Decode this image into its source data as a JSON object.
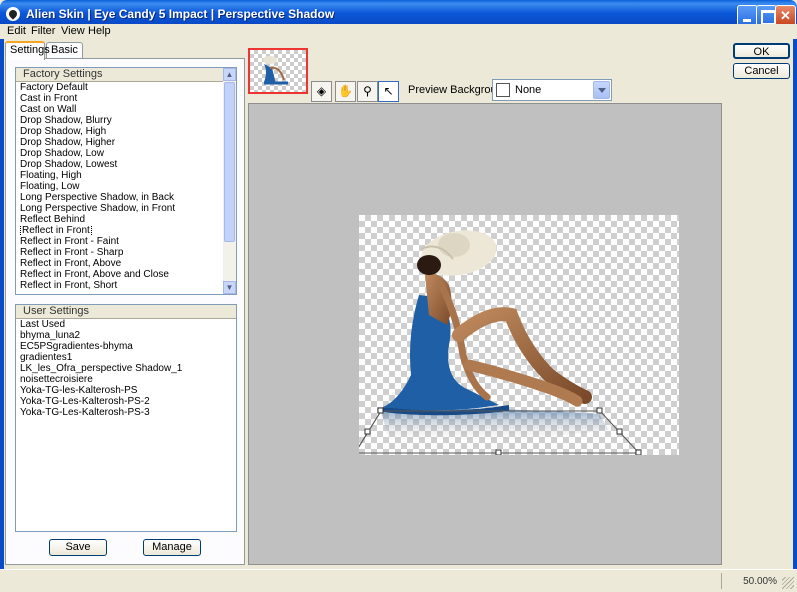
{
  "window": {
    "title": "Alien Skin  |  Eye Candy 5 Impact  |  Perspective Shadow"
  },
  "menu": [
    "Edit",
    "Filter",
    "View",
    "Help"
  ],
  "tabs": [
    {
      "label": "Settings",
      "active": true
    },
    {
      "label": "Basic",
      "active": false
    }
  ],
  "factory_settings": {
    "header": "Factory Settings",
    "selected": "Reflect in Front",
    "items": [
      "Factory Default",
      "Cast in Front",
      "Cast on Wall",
      "Drop Shadow, Blurry",
      "Drop Shadow, High",
      "Drop Shadow, Higher",
      "Drop Shadow, Low",
      "Drop Shadow, Lowest",
      "Floating, High",
      "Floating, Low",
      "Long Perspective Shadow, in Back",
      "Long Perspective Shadow, in Front",
      "Reflect Behind",
      "Reflect in Front",
      "Reflect in Front - Faint",
      "Reflect in Front - Sharp",
      "Reflect in Front, Above",
      "Reflect in Front, Above and Close",
      "Reflect in Front, Short"
    ]
  },
  "user_settings": {
    "header": "User Settings",
    "items": [
      "Last Used",
      "bhyma_luna2",
      "EC5PSgradientes-bhyma",
      "gradientes1",
      "LK_les_Ofra_perspective Shadow_1",
      "noisettecroisiere",
      "Yoka-TG-les-Kalterosh-PS",
      "Yoka-TG-Les-Kalterosh-PS-2",
      "Yoka-TG-Les-Kalterosh-PS-3"
    ]
  },
  "buttons": {
    "save": "Save",
    "manage": "Manage",
    "ok": "OK",
    "cancel": "Cancel"
  },
  "preview": {
    "background_label": "Preview Background:",
    "background_value": "None"
  },
  "status": {
    "zoom": "50.00%"
  },
  "colors": {
    "title_bar": "#0a4bc7",
    "canvas_bg": "#c0c0c0",
    "thumb_border": "#e33333",
    "dress": "#1e5fa6",
    "hat": "#ece7d6"
  }
}
